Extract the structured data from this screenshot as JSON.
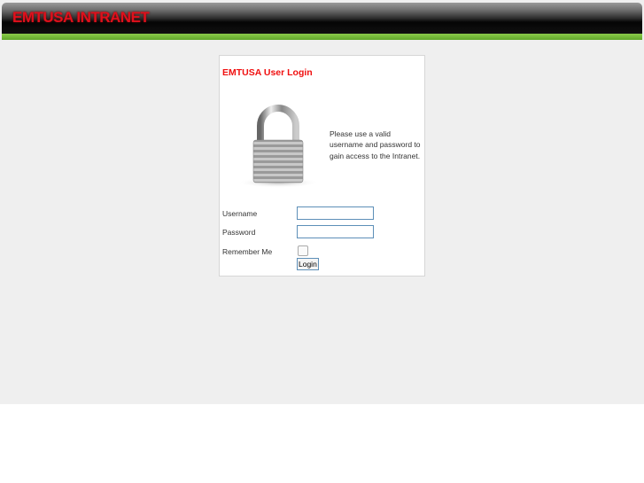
{
  "header": {
    "logo": "EMTUSA INTRANET"
  },
  "login": {
    "title": "EMTUSA User Login",
    "message": "Please use a valid username and password to gain access to the Intranet.",
    "username_label": "Username",
    "username_value": "",
    "password_label": "Password",
    "password_value": "",
    "remember_label": "Remember Me",
    "remember_checked": false,
    "login_button": "Login"
  }
}
